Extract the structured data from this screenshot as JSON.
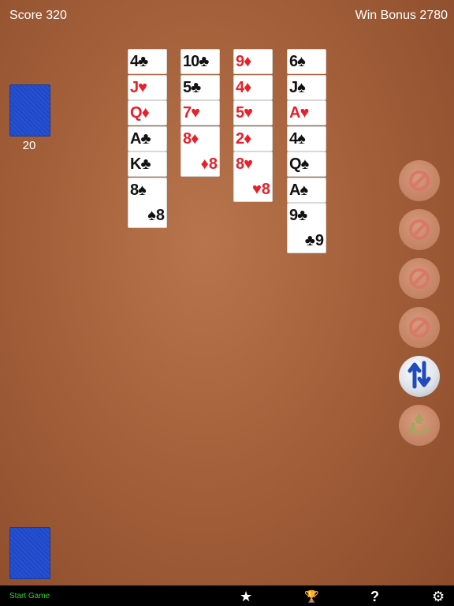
{
  "header": {
    "score": "Score 320",
    "win_bonus": "Win Bonus 2780"
  },
  "stock": {
    "count": "20"
  },
  "tableau": [
    {
      "cards": [
        {
          "rank": "4",
          "suit": "♣",
          "color": "black"
        },
        {
          "rank": "J",
          "suit": "♥",
          "color": "red"
        },
        {
          "rank": "Q",
          "suit": "♦",
          "color": "red"
        },
        {
          "rank": "A",
          "suit": "♣",
          "color": "black"
        },
        {
          "rank": "K",
          "suit": "♣",
          "color": "black"
        },
        {
          "rank": "8",
          "suit": "♠",
          "color": "black"
        }
      ]
    },
    {
      "cards": [
        {
          "rank": "10",
          "suit": "♣",
          "color": "black"
        },
        {
          "rank": "5",
          "suit": "♣",
          "color": "black"
        },
        {
          "rank": "7",
          "suit": "♥",
          "color": "red"
        },
        {
          "rank": "8",
          "suit": "♦",
          "color": "red"
        }
      ]
    },
    {
      "cards": [
        {
          "rank": "9",
          "suit": "♦",
          "color": "red"
        },
        {
          "rank": "4",
          "suit": "♦",
          "color": "red"
        },
        {
          "rank": "5",
          "suit": "♥",
          "color": "red"
        },
        {
          "rank": "2",
          "suit": "♦",
          "color": "red"
        },
        {
          "rank": "8",
          "suit": "♥",
          "color": "red"
        }
      ]
    },
    {
      "cards": [
        {
          "rank": "6",
          "suit": "♠",
          "color": "black"
        },
        {
          "rank": "J",
          "suit": "♠",
          "color": "black"
        },
        {
          "rank": "A",
          "suit": "♥",
          "color": "red"
        },
        {
          "rank": "4",
          "suit": "♠",
          "color": "black"
        },
        {
          "rank": "Q",
          "suit": "♠",
          "color": "black"
        },
        {
          "rank": "A",
          "suit": "♠",
          "color": "black"
        },
        {
          "rank": "9",
          "suit": "♣",
          "color": "black"
        }
      ]
    }
  ],
  "side_buttons": [
    {
      "name": "blocked-slot-1",
      "icon": "no-entry-icon"
    },
    {
      "name": "blocked-slot-2",
      "icon": "no-entry-icon"
    },
    {
      "name": "blocked-slot-3",
      "icon": "no-entry-icon"
    },
    {
      "name": "blocked-slot-4",
      "icon": "no-entry-icon"
    },
    {
      "name": "undo-button",
      "icon": "swap-arrows-icon"
    },
    {
      "name": "recycle-button",
      "icon": "recycle-icon"
    }
  ],
  "toolbar": {
    "start_game": "Start Game",
    "star": "★",
    "trophy": "🏆",
    "help": "?",
    "settings": "⚙"
  },
  "colors": {
    "felt": "#a4603a",
    "card_back": "#1d48c9",
    "red_suit": "#e8202a",
    "start_text": "#2fd12f"
  }
}
